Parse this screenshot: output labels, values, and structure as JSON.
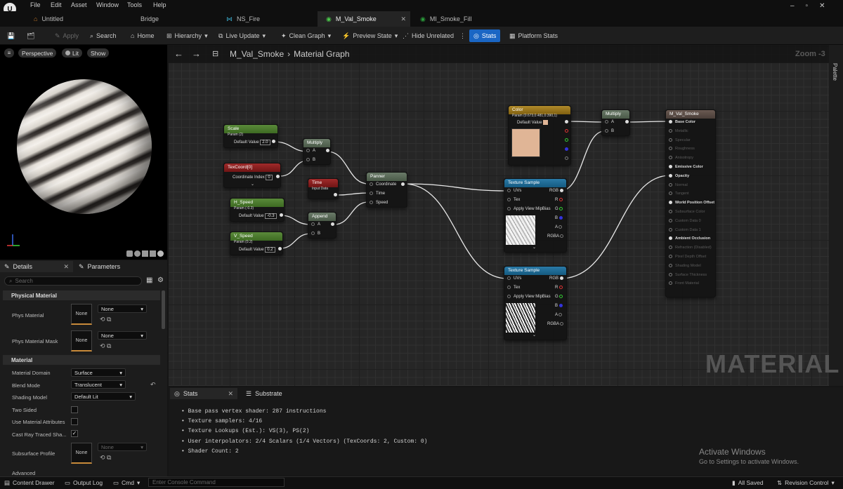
{
  "menu": [
    "File",
    "Edit",
    "Asset",
    "Window",
    "Tools",
    "Help"
  ],
  "tabs": [
    "Untitled",
    "Bridge",
    "NS_Fire",
    "M_Val_Smoke",
    "MI_Smoke_Fill"
  ],
  "toolbar": {
    "apply": "Apply",
    "search": "Search",
    "home": "Home",
    "hierarchy": "Hierarchy",
    "live_update": "Live Update",
    "clean_graph": "Clean Graph",
    "preview_state": "Preview State",
    "hide_unrelated": "Hide Unrelated",
    "stats": "Stats",
    "platform_stats": "Platform Stats"
  },
  "viewport": {
    "perspective": "Perspective",
    "lit": "Lit",
    "show": "Show"
  },
  "details": {
    "tab_details": "Details",
    "tab_parameters": "Parameters",
    "search_placeholder": "Search",
    "physical_material": "Physical Material",
    "phys_material": "Phys Material",
    "phys_material_mask": "Phys Material Mask",
    "none": "None",
    "material": "Material",
    "material_domain": "Material Domain",
    "material_domain_value": "Surface",
    "blend_mode": "Blend Mode",
    "blend_mode_value": "Translucent",
    "shading_model": "Shading Model",
    "shading_model_value": "Default Lit",
    "two_sided": "Two Sided",
    "use_material_attributes": "Use Material Attributes",
    "cast_ray_traced": "Cast Ray Traced Sha...",
    "subsurface_profile": "Subsurface Profile",
    "advanced": "Advanced"
  },
  "graph": {
    "title": "M_Val_Smoke",
    "breadcrumb": "Material Graph",
    "zoom": "Zoom -3",
    "watermark": "MATERIAL",
    "palette": "Palette",
    "nodes": {
      "scale": {
        "title": "Scale",
        "sub": "Param (2)",
        "label": "Default Value",
        "value": "2.0"
      },
      "texcoord": {
        "title": "TexCoord[0]",
        "label": "Coordinate Index",
        "value": "0"
      },
      "multiply1": {
        "title": "Multiply",
        "a": "A",
        "b": "B"
      },
      "time": {
        "title": "Time",
        "sub": "Input Data"
      },
      "panner": {
        "title": "Panner",
        "coordinate": "Coordinate",
        "time": "Time",
        "speed": "Speed"
      },
      "h_speed": {
        "title": "H_Speed",
        "sub": "Param (-0.3)",
        "label": "Default Value",
        "value": "-0.3"
      },
      "v_speed": {
        "title": "V_Speed",
        "sub": "Param (0.2)",
        "label": "Default Value",
        "value": "0.2"
      },
      "append": {
        "title": "Append",
        "a": "A",
        "b": "B"
      },
      "color": {
        "title": "Color",
        "sub": "Param (0.673,0.481,0.390,1)",
        "label": "Default Value"
      },
      "multiply2": {
        "title": "Multiply",
        "a": "A",
        "b": "B"
      },
      "tex1": {
        "title": "Texture Sample",
        "uvs": "UVs",
        "tex": "Tex",
        "mip": "Apply View MipBias",
        "rgb": "RGB",
        "r": "R",
        "g": "G",
        "b": "B",
        "a": "A",
        "rgba": "RGBA"
      },
      "tex2": {
        "title": "Texture Sample",
        "uvs": "UVs",
        "tex": "Tex",
        "mip": "Apply View MipBias",
        "rgb": "RGB",
        "r": "R",
        "g": "G",
        "b": "B",
        "a": "A",
        "rgba": "RGBA"
      },
      "output": {
        "title": "M_Val_Smoke",
        "pins": [
          "Base Color",
          "Metallic",
          "Specular",
          "Roughness",
          "Anisotropy",
          "Emissive Color",
          "Opacity",
          "Normal",
          "Tangent",
          "World Position Offset",
          "Subsurface Color",
          "Custom Data 0",
          "Custom Data 1",
          "Ambient Occlusion",
          "Refraction (Disabled)",
          "Pixel Depth Offset",
          "Shading Model",
          "Surface Thickness",
          "Front Material"
        ],
        "active": [
          true,
          false,
          false,
          false,
          false,
          true,
          true,
          false,
          false,
          true,
          false,
          false,
          false,
          true,
          false,
          false,
          false,
          false,
          false
        ]
      }
    }
  },
  "stats_panel": {
    "tab_stats": "Stats",
    "tab_substrate": "Substrate",
    "lines": [
      "Base pass vertex shader: 287 instructions",
      "Texture samplers: 4/16",
      "Texture Lookups (Est.): VS(3), PS(2)",
      "User interpolators: 2/4 Scalars (1/4 Vectors) (TexCoords: 2, Custom: 0)",
      "Shader Count: 2"
    ]
  },
  "activate": {
    "title": "Activate Windows",
    "sub": "Go to Settings to activate Windows."
  },
  "bottom": {
    "content_drawer": "Content Drawer",
    "output_log": "Output Log",
    "cmd": "Cmd",
    "console_placeholder": "Enter Console Command",
    "all_saved": "All Saved",
    "revision_control": "Revision Control"
  },
  "colors": {
    "accent": "#1a66c4",
    "swatch": "#e0b596"
  }
}
